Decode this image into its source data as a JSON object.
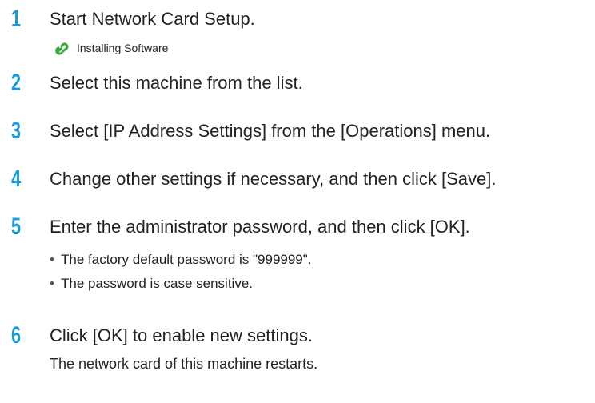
{
  "colors": {
    "step_number": "#1a9ad6",
    "text": "#222222",
    "link_icon": "#3aa83a"
  },
  "steps": [
    {
      "number": "1",
      "text": "Start Network Card Setup.",
      "link": {
        "icon": "chain-link-icon",
        "text": "Installing Software"
      }
    },
    {
      "number": "2",
      "text": "Select this machine from the list."
    },
    {
      "number": "3",
      "text": "Select [IP Address Settings] from the [Operations] menu."
    },
    {
      "number": "4",
      "text": "Change other settings if necessary, and then click [Save]."
    },
    {
      "number": "5",
      "text": "Enter the administrator password, and then click [OK].",
      "bullets": [
        "The factory default password is \"999999\".",
        "The password is case sensitive."
      ]
    },
    {
      "number": "6",
      "text": "Click [OK] to enable new settings.",
      "note": "The network card of this machine restarts."
    }
  ]
}
